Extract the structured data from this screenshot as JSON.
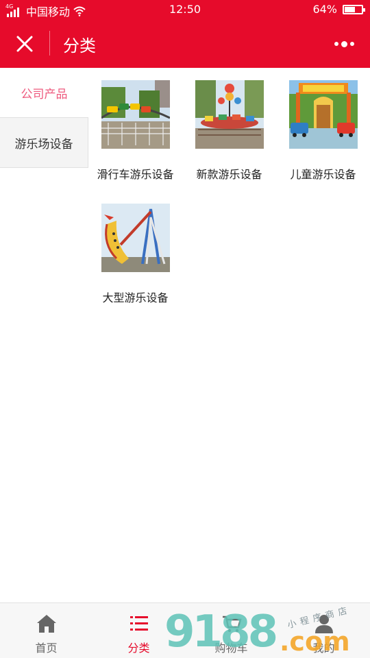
{
  "status_bar": {
    "network": "4G",
    "carrier": "中国移动",
    "time": "12:50",
    "battery": "64%",
    "battery_level": 0.64
  },
  "nav": {
    "title": "分类"
  },
  "sidebar": {
    "items": [
      {
        "label": "公司产品",
        "active": true
      },
      {
        "label": "游乐场设备",
        "active": false
      }
    ]
  },
  "products": [
    {
      "name": "滑行车游乐设备",
      "image": "roller-coaster-photo"
    },
    {
      "name": "新款游乐设备",
      "image": "carousel-ride-photo"
    },
    {
      "name": "儿童游乐设备",
      "image": "kiddie-train-photo"
    },
    {
      "name": "大型游乐设备",
      "image": "pirate-ship-photo"
    }
  ],
  "tab_bar": {
    "tabs": [
      {
        "label": "首页",
        "icon": "home-icon"
      },
      {
        "label": "分类",
        "icon": "list-icon",
        "active": true
      },
      {
        "label": "购物车",
        "icon": "cart-icon"
      },
      {
        "label": "我的",
        "icon": "user-icon"
      }
    ]
  },
  "watermark": {
    "digits": "9188",
    "domain": ".com",
    "tagline": "小程序商店"
  },
  "colors": {
    "brand_red": "#e60b2b",
    "sidebar_active": "#ee5a7e",
    "watermark_teal": "#5ec3b7",
    "watermark_orange": "#f4a72a"
  }
}
